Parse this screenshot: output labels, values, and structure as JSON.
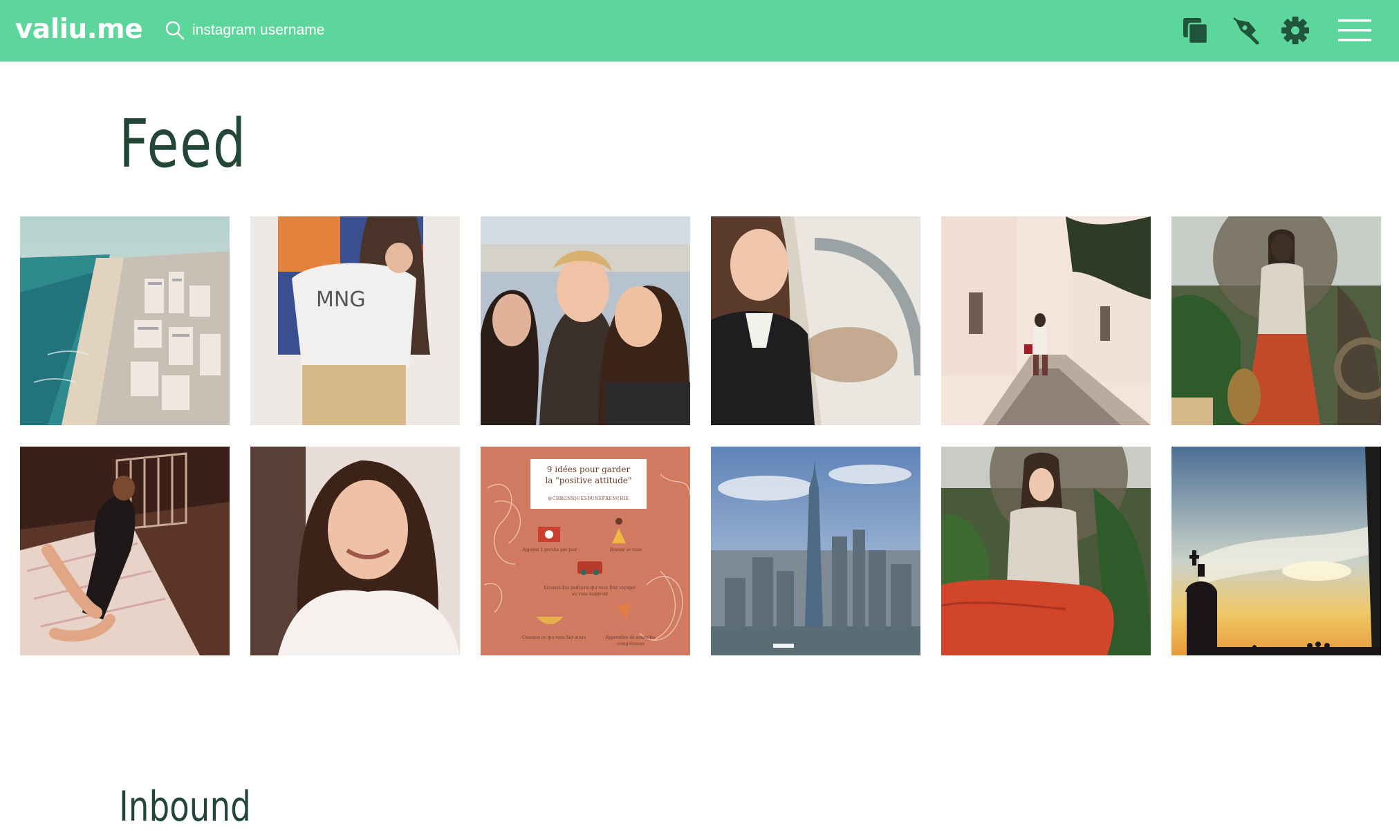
{
  "header": {
    "logo": "valiu.me",
    "search_placeholder": "instagram username",
    "icons": [
      "copy-icon",
      "edit-pen-icon",
      "settings-gear-icon",
      "menu-icon"
    ],
    "background": "#5dd69c"
  },
  "main": {
    "title": "Feed",
    "bottom_heading": "Inbound"
  },
  "poster": {
    "line1": "9 idées pour garder",
    "line2": "la \"positive attitude\"",
    "handle": "@CHRONIQUESDUNEFRENCHIE",
    "item1": "Appelez 1 proche par jour",
    "item2": "Danser se vous",
    "item3": "Écoutez des podcasts qui vous font voyager ou vous inspirent",
    "item4": "Cuisinez ce qui vous fait envie",
    "item5": "Apprendre de nouvelles compétences"
  },
  "colors": {
    "title": "#234636",
    "poster_bg": "#d07a62"
  }
}
